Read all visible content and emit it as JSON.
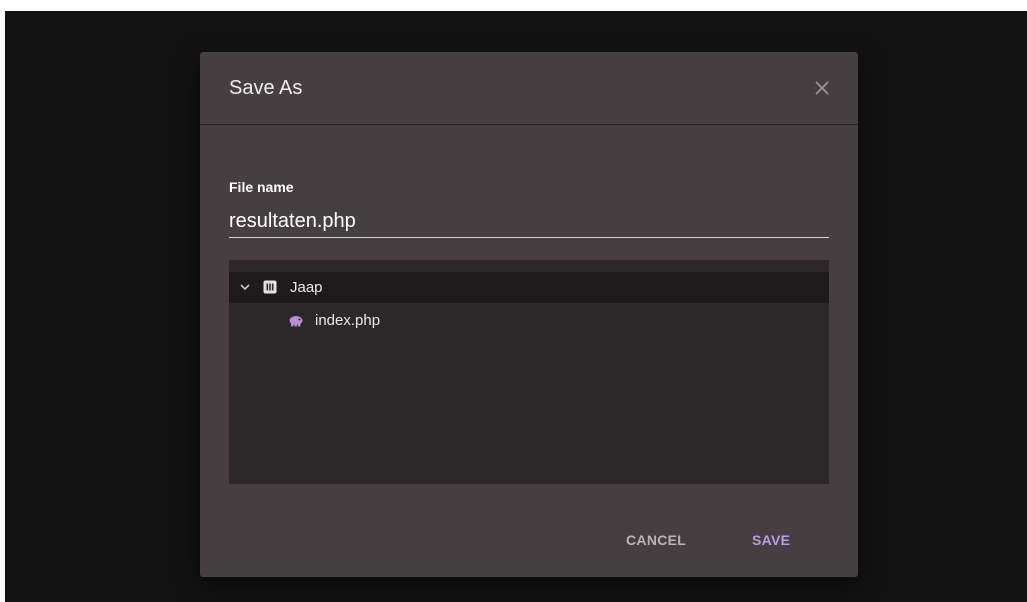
{
  "dialog": {
    "title": "Save As",
    "file_name_label": "File name",
    "file_name_value": "resultaten.php",
    "cancel_label": "CANCEL",
    "save_label": "SAVE"
  },
  "tree": {
    "items": [
      {
        "label": "Jaap",
        "icon": "folder-icon",
        "expanded": true,
        "selected": true
      },
      {
        "label": "index.php",
        "icon": "php-elephant-icon",
        "selected": false
      }
    ]
  },
  "colors": {
    "backdrop": "#121212",
    "dialog": "#463e40",
    "tree_bg": "#2c2829",
    "accent": "#b99ce2",
    "php_icon": "#b68fd4"
  }
}
